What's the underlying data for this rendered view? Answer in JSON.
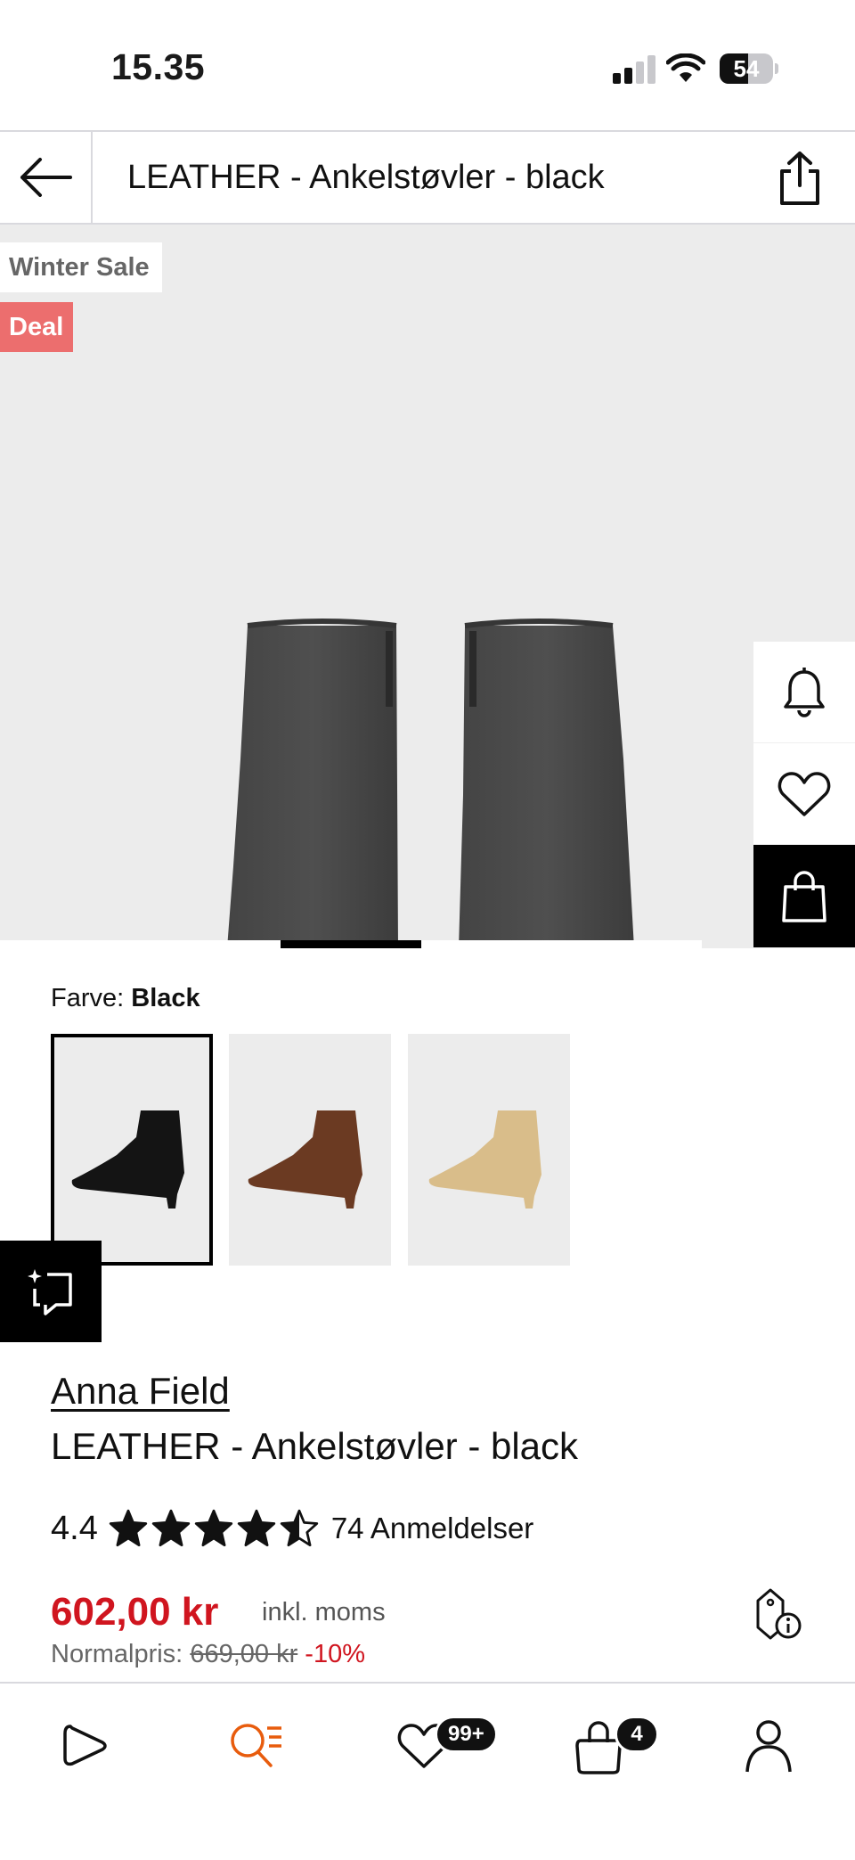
{
  "status_bar": {
    "time": "15.35",
    "battery": "54",
    "battery_level": 0.54,
    "signal_bars_active": 2,
    "signal_bars_total": 4
  },
  "header": {
    "back_icon": "arrow-left-icon",
    "title": "LEATHER - Ankelstøvler - black",
    "share_icon": "share-icon"
  },
  "hero": {
    "badges": {
      "sale": "Winter Sale",
      "deal": "Deal"
    },
    "badge_colors": {
      "deal": "#ec6e6e"
    },
    "image_description_icon": "boots-image",
    "gallery_progress": {
      "current_index": 2,
      "total": 5
    },
    "side_actions": [
      "bell-icon",
      "heart-icon",
      "shopping-bag-icon"
    ]
  },
  "color_selector": {
    "label": "Farve:",
    "selected": "Black",
    "options": [
      {
        "color_name": "black",
        "hex": "#141414",
        "selected": true
      },
      {
        "color_name": "brown",
        "hex": "#6b3a22",
        "selected": false
      },
      {
        "color_name": "beige",
        "hex": "#d9bd8a",
        "selected": false
      }
    ]
  },
  "compare_icon": "compare-sparkle-icon",
  "product": {
    "brand": "Anna Field",
    "name": "LEATHER - Ankelstøvler - black",
    "rating": "4.4",
    "rating_value": 4.4,
    "reviews": "74 Anmeldelser",
    "price": "602,00 kr",
    "incl_vat": "inkl. moms",
    "normal_price_label": "Normalpris:",
    "normal_price": "669,00 kr",
    "discount": "-10%",
    "price_color": "#d0151f",
    "price_info_icon": "price-tag-info-icon"
  },
  "bottom_nav": {
    "items": [
      {
        "icon": "play-home-icon",
        "active": false
      },
      {
        "icon": "search-list-icon",
        "active": true
      },
      {
        "icon": "heart-icon",
        "active": false,
        "badge": "99+"
      },
      {
        "icon": "shopping-bag-icon",
        "active": false,
        "badge": "4"
      },
      {
        "icon": "profile-icon",
        "active": false
      }
    ],
    "active_color": "#e85c0d"
  }
}
